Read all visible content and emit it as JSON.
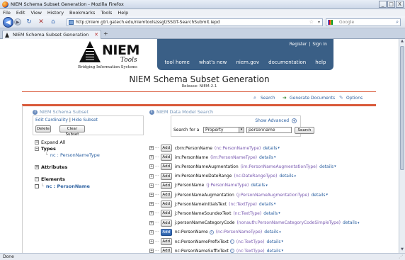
{
  "window": {
    "title": "NIEM Schema Subset Generation - Mozilla Firefox",
    "buttons": [
      "_",
      "□",
      "X"
    ]
  },
  "menu": [
    "File",
    "Edit",
    "View",
    "History",
    "Bookmarks",
    "Tools",
    "Help"
  ],
  "nav": {
    "url": "http://niem.gtri.gatech.edu/niemtools/ssgt/SSGT-SearchSubmit.iepd",
    "search_placeholder": "Google"
  },
  "tab": {
    "label": "NIEM Schema Subset Generation",
    "new_tab": "+"
  },
  "header": {
    "logo_text": "NIEM",
    "logo_sub": "Tools",
    "logo_tag": "Bridging Information Systems",
    "register": "Register",
    "sign_in": "Sign In",
    "nav": [
      "tool home",
      "what's new",
      "niem.gov",
      "documentation",
      "help"
    ]
  },
  "page": {
    "title": "NIEM Schema Subset Generation",
    "release": "Release: NIEM-2.1"
  },
  "toolbar": {
    "search": "Search",
    "generate": "Generate Documents",
    "options": "Options"
  },
  "left": {
    "heading": "NIEM Schema Subset",
    "edit_cardinality": "Edit Cardinality",
    "separator": "|",
    "hide_subset": "Hide Subset",
    "delete_label": "Delete",
    "clear_label": "Clear Subset",
    "expand_all": "Expand All",
    "types": "Types",
    "type_item": "nc : PersonNameType",
    "attributes": "Attributes",
    "elements": "Elements",
    "element_item": "nc : PersonName"
  },
  "right": {
    "heading": "NIEM Data Model Search",
    "show_advanced": "Show Advanced",
    "search_for": "Search for a",
    "select_value": "Property",
    "query": "personname",
    "search_button": "Search",
    "add_label": "Add",
    "details_label": "details",
    "results": [
      {
        "name": "cbrn:PersonName",
        "type": "(nc:PersonNameType)",
        "active": false,
        "info": false
      },
      {
        "name": "im:PersonName",
        "type": "(im:PersonNameType)",
        "active": false,
        "info": false
      },
      {
        "name": "im:PersonNameAugmentation",
        "type": "(im:PersonNameAugmentationType)",
        "active": false,
        "info": false
      },
      {
        "name": "im:PersonNameDateRange",
        "type": "(nc:DateRangeType)",
        "active": false,
        "info": false
      },
      {
        "name": "j:PersonName",
        "type": "(j:PersonNameType)",
        "active": false,
        "info": false
      },
      {
        "name": "j:PersonNameAugmentation",
        "type": "(j:PersonNameAugmentationType)",
        "active": false,
        "info": false
      },
      {
        "name": "j:PersonNameInitialsText",
        "type": "(nc:TextType)",
        "active": false,
        "info": false
      },
      {
        "name": "j:PersonNameSoundexText",
        "type": "(nc:TextType)",
        "active": false,
        "info": false
      },
      {
        "name": "j:personNameCategoryCode",
        "type": "(nonauth:PersonNameCategoryCodeSimpleType)",
        "active": false,
        "info": false
      },
      {
        "name": "nc:PersonName",
        "type": "(nc:PersonNameType)",
        "active": true,
        "info": true
      },
      {
        "name": "nc:PersonNamePrefixText",
        "type": "(nc:TextType)",
        "active": false,
        "info": true
      },
      {
        "name": "nc:PersonNameSuffixText",
        "type": "(nc:TextType)",
        "active": false,
        "info": true
      }
    ]
  },
  "status": "Done"
}
